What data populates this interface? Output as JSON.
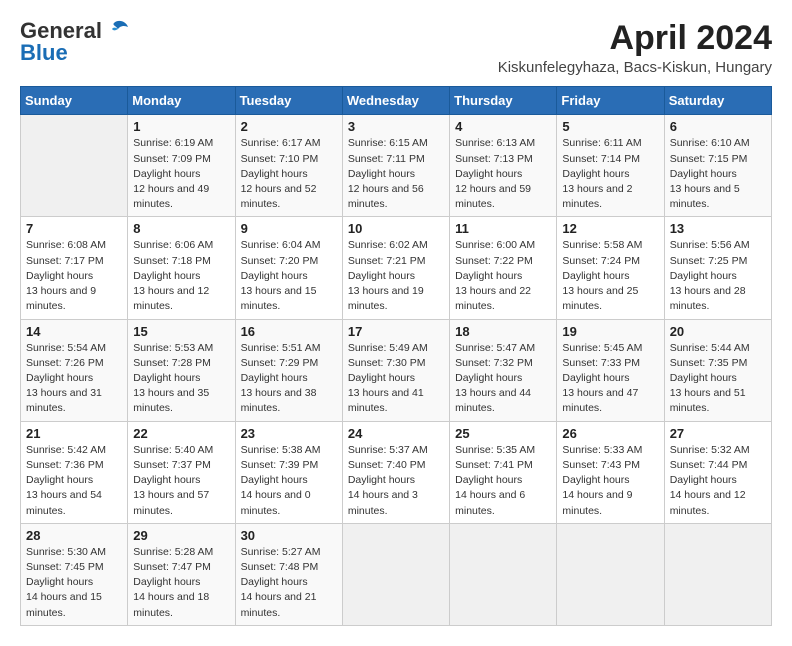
{
  "header": {
    "logo_general": "General",
    "logo_blue": "Blue",
    "month_title": "April 2024",
    "subtitle": "Kiskunfelegyhaza, Bacs-Kiskun, Hungary"
  },
  "weekdays": [
    "Sunday",
    "Monday",
    "Tuesday",
    "Wednesday",
    "Thursday",
    "Friday",
    "Saturday"
  ],
  "weeks": [
    [
      {
        "day": "",
        "empty": true
      },
      {
        "day": "1",
        "sunrise": "6:19 AM",
        "sunset": "7:09 PM",
        "daylight": "12 hours and 49 minutes."
      },
      {
        "day": "2",
        "sunrise": "6:17 AM",
        "sunset": "7:10 PM",
        "daylight": "12 hours and 52 minutes."
      },
      {
        "day": "3",
        "sunrise": "6:15 AM",
        "sunset": "7:11 PM",
        "daylight": "12 hours and 56 minutes."
      },
      {
        "day": "4",
        "sunrise": "6:13 AM",
        "sunset": "7:13 PM",
        "daylight": "12 hours and 59 minutes."
      },
      {
        "day": "5",
        "sunrise": "6:11 AM",
        "sunset": "7:14 PM",
        "daylight": "13 hours and 2 minutes."
      },
      {
        "day": "6",
        "sunrise": "6:10 AM",
        "sunset": "7:15 PM",
        "daylight": "13 hours and 5 minutes."
      }
    ],
    [
      {
        "day": "7",
        "sunrise": "6:08 AM",
        "sunset": "7:17 PM",
        "daylight": "13 hours and 9 minutes."
      },
      {
        "day": "8",
        "sunrise": "6:06 AM",
        "sunset": "7:18 PM",
        "daylight": "13 hours and 12 minutes."
      },
      {
        "day": "9",
        "sunrise": "6:04 AM",
        "sunset": "7:20 PM",
        "daylight": "13 hours and 15 minutes."
      },
      {
        "day": "10",
        "sunrise": "6:02 AM",
        "sunset": "7:21 PM",
        "daylight": "13 hours and 19 minutes."
      },
      {
        "day": "11",
        "sunrise": "6:00 AM",
        "sunset": "7:22 PM",
        "daylight": "13 hours and 22 minutes."
      },
      {
        "day": "12",
        "sunrise": "5:58 AM",
        "sunset": "7:24 PM",
        "daylight": "13 hours and 25 minutes."
      },
      {
        "day": "13",
        "sunrise": "5:56 AM",
        "sunset": "7:25 PM",
        "daylight": "13 hours and 28 minutes."
      }
    ],
    [
      {
        "day": "14",
        "sunrise": "5:54 AM",
        "sunset": "7:26 PM",
        "daylight": "13 hours and 31 minutes."
      },
      {
        "day": "15",
        "sunrise": "5:53 AM",
        "sunset": "7:28 PM",
        "daylight": "13 hours and 35 minutes."
      },
      {
        "day": "16",
        "sunrise": "5:51 AM",
        "sunset": "7:29 PM",
        "daylight": "13 hours and 38 minutes."
      },
      {
        "day": "17",
        "sunrise": "5:49 AM",
        "sunset": "7:30 PM",
        "daylight": "13 hours and 41 minutes."
      },
      {
        "day": "18",
        "sunrise": "5:47 AM",
        "sunset": "7:32 PM",
        "daylight": "13 hours and 44 minutes."
      },
      {
        "day": "19",
        "sunrise": "5:45 AM",
        "sunset": "7:33 PM",
        "daylight": "13 hours and 47 minutes."
      },
      {
        "day": "20",
        "sunrise": "5:44 AM",
        "sunset": "7:35 PM",
        "daylight": "13 hours and 51 minutes."
      }
    ],
    [
      {
        "day": "21",
        "sunrise": "5:42 AM",
        "sunset": "7:36 PM",
        "daylight": "13 hours and 54 minutes."
      },
      {
        "day": "22",
        "sunrise": "5:40 AM",
        "sunset": "7:37 PM",
        "daylight": "13 hours and 57 minutes."
      },
      {
        "day": "23",
        "sunrise": "5:38 AM",
        "sunset": "7:39 PM",
        "daylight": "14 hours and 0 minutes."
      },
      {
        "day": "24",
        "sunrise": "5:37 AM",
        "sunset": "7:40 PM",
        "daylight": "14 hours and 3 minutes."
      },
      {
        "day": "25",
        "sunrise": "5:35 AM",
        "sunset": "7:41 PM",
        "daylight": "14 hours and 6 minutes."
      },
      {
        "day": "26",
        "sunrise": "5:33 AM",
        "sunset": "7:43 PM",
        "daylight": "14 hours and 9 minutes."
      },
      {
        "day": "27",
        "sunrise": "5:32 AM",
        "sunset": "7:44 PM",
        "daylight": "14 hours and 12 minutes."
      }
    ],
    [
      {
        "day": "28",
        "sunrise": "5:30 AM",
        "sunset": "7:45 PM",
        "daylight": "14 hours and 15 minutes."
      },
      {
        "day": "29",
        "sunrise": "5:28 AM",
        "sunset": "7:47 PM",
        "daylight": "14 hours and 18 minutes."
      },
      {
        "day": "30",
        "sunrise": "5:27 AM",
        "sunset": "7:48 PM",
        "daylight": "14 hours and 21 minutes."
      },
      {
        "day": "",
        "empty": true
      },
      {
        "day": "",
        "empty": true
      },
      {
        "day": "",
        "empty": true
      },
      {
        "day": "",
        "empty": true
      }
    ]
  ],
  "labels": {
    "sunrise": "Sunrise:",
    "sunset": "Sunset:",
    "daylight": "Daylight hours"
  }
}
